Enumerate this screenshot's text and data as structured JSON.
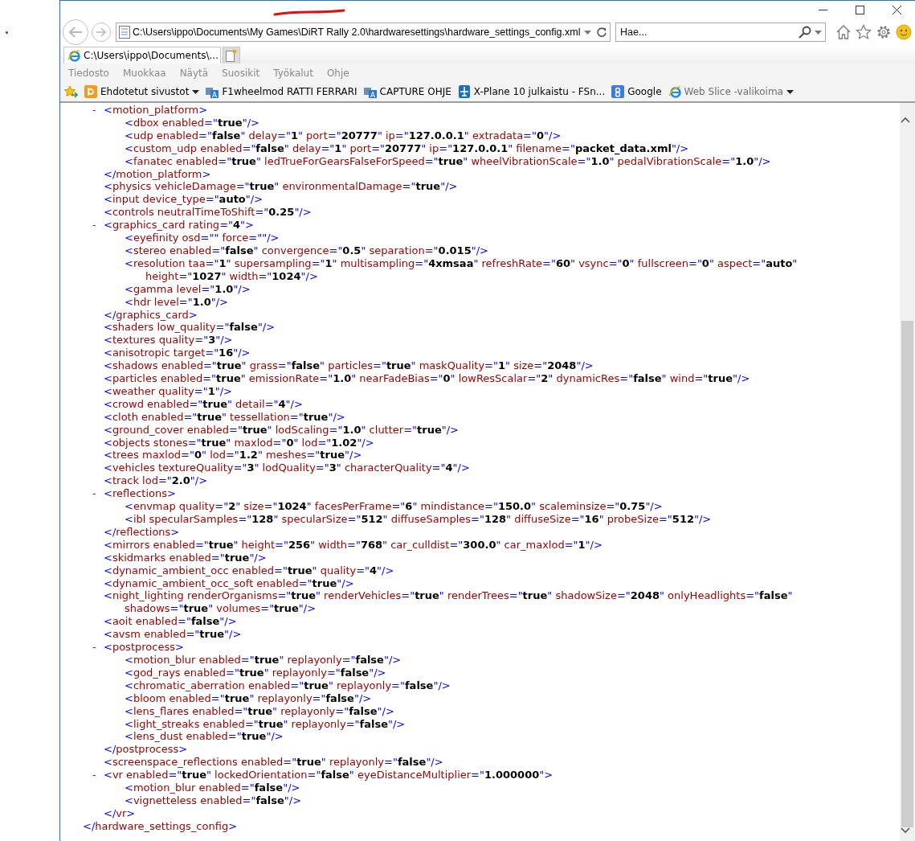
{
  "browser": {
    "address": {
      "value": "C:\\Users\\ippo\\Documents\\My Games\\DiRT Rally 2.0\\hardwaresettings\\hardware_settings_config.xml"
    },
    "search": {
      "placeholder": "Hae..."
    },
    "tabs": [
      {
        "title": "C:\\Users\\ippo\\Documents\\...",
        "selected": true
      }
    ],
    "menu": [
      "Tiedosto",
      "Muokkaa",
      "Näytä",
      "Suosikit",
      "Työkalut",
      "Ohje"
    ],
    "favorites": [
      {
        "label": "Ehdotetut sivustot",
        "kind": "bing",
        "dropdown": true,
        "disabled": false
      },
      {
        "label": "F1wheelmod RATTI FERRARI",
        "kind": "translator",
        "dropdown": false,
        "disabled": false
      },
      {
        "label": "CAPTURE OHJE",
        "kind": "translator",
        "dropdown": false,
        "disabled": false
      },
      {
        "label": "X-Plane 10 julkaistu - FSn...",
        "kind": "plane",
        "dropdown": false,
        "disabled": false
      },
      {
        "label": "Google",
        "kind": "google",
        "dropdown": false,
        "disabled": false
      },
      {
        "label": "Web Slice -valikoima",
        "kind": "ie",
        "dropdown": true,
        "disabled": true
      }
    ]
  },
  "document": {
    "close": "</hardware_settings_config>",
    "children": [
      {
        "toggle": "-",
        "open": "<motion_platform>",
        "close": "</motion_platform>",
        "children": [
          {
            "open": "<dbox enabled=\"true\"/>"
          },
          {
            "open": "<udp enabled=\"false\" delay=\"1\" port=\"20777\" ip=\"127.0.0.1\" extradata=\"0\"/>"
          },
          {
            "open": "<custom_udp enabled=\"false\" delay=\"1\" port=\"20777\" ip=\"127.0.0.1\" filename=\"packet_data.xml\"/>"
          },
          {
            "open": "<fanatec enabled=\"true\" ledTrueForGearsFalseForSpeed=\"true\" wheelVibrationScale=\"1.0\" pedalVibrationScale=\"1.0\"/>"
          }
        ]
      },
      {
        "open": "<physics vehicleDamage=\"true\" environmentalDamage=\"true\"/>"
      },
      {
        "open": "<input device_type=\"auto\"/>"
      },
      {
        "open": "<controls neutralTimeToShift=\"0.25\"/>"
      },
      {
        "toggle": "-",
        "open": "<graphics_card rating=\"4\">",
        "close": "</graphics_card>",
        "children": [
          {
            "open": "<eyefinity osd=\"\" force=\"\"/>"
          },
          {
            "open": "<stereo enabled=\"false\" convergence=\"0.5\" separation=\"0.015\"/>"
          },
          {
            "open": "<resolution taa=\"1\" supersampling=\"1\" multisampling=\"4xmsaa\" refreshRate=\"60\" vsync=\"0\" fullscreen=\"0\" aspect=\"auto\"",
            "wrap": "height=\"1027\" width=\"1024\"/>"
          },
          {
            "open": "<gamma level=\"1.0\"/>"
          },
          {
            "open": "<hdr level=\"1.0\"/>"
          }
        ]
      },
      {
        "open": "<shaders low_quality=\"false\"/>"
      },
      {
        "open": "<textures quality=\"3\"/>"
      },
      {
        "open": "<anisotropic target=\"16\"/>"
      },
      {
        "open": "<shadows enabled=\"true\" grass=\"false\" particles=\"true\" maskQuality=\"1\" size=\"2048\"/>"
      },
      {
        "open": "<particles enabled=\"true\" emissionRate=\"1.0\" nearFadeBias=\"0\" lowResScalar=\"2\" dynamicRes=\"false\" wind=\"true\"/>"
      },
      {
        "open": "<weather quality=\"1\"/>"
      },
      {
        "open": "<crowd enabled=\"true\" detail=\"4\"/>"
      },
      {
        "open": "<cloth enabled=\"true\" tessellation=\"true\"/>"
      },
      {
        "open": "<ground_cover enabled=\"true\" lodScaling=\"1.0\" clutter=\"true\"/>"
      },
      {
        "open": "<objects stones=\"true\" maxlod=\"0\" lod=\"1.02\"/>"
      },
      {
        "open": "<trees maxlod=\"0\" lod=\"1.2\" meshes=\"true\"/>"
      },
      {
        "open": "<vehicles textureQuality=\"3\" lodQuality=\"3\" characterQuality=\"4\"/>"
      },
      {
        "open": "<track lod=\"2.0\"/>"
      },
      {
        "toggle": "-",
        "open": "<reflections>",
        "close": "</reflections>",
        "children": [
          {
            "open": "<envmap quality=\"2\" size=\"1024\" facesPerFrame=\"6\" mindistance=\"150.0\" scaleminsize=\"0.75\"/>"
          },
          {
            "open": "<ibl specularSamples=\"128\" specularSize=\"512\" diffuseSamples=\"128\" diffuseSize=\"16\" probeSize=\"512\"/>"
          }
        ]
      },
      {
        "open": "<mirrors enabled=\"true\" height=\"256\" width=\"768\" car_culldist=\"300.0\" car_maxlod=\"1\"/>"
      },
      {
        "open": "<skidmarks enabled=\"true\"/>"
      },
      {
        "open": "<dynamic_ambient_occ enabled=\"true\" quality=\"4\"/>"
      },
      {
        "open": "<dynamic_ambient_occ_soft enabled=\"true\"/>"
      },
      {
        "open": "<night_lighting renderOrganisms=\"true\" renderVehicles=\"true\" renderTrees=\"true\" shadowSize=\"2048\" onlyHeadlights=\"false\"",
        "wrap": "shadows=\"true\" volumes=\"true\"/>"
      },
      {
        "open": "<aoit enabled=\"false\"/>"
      },
      {
        "open": "<avsm enabled=\"true\"/>"
      },
      {
        "toggle": "-",
        "open": "<postprocess>",
        "close": "</postprocess>",
        "children": [
          {
            "open": "<motion_blur enabled=\"true\" replayonly=\"false\"/>"
          },
          {
            "open": "<god_rays enabled=\"true\" replayonly=\"false\"/>"
          },
          {
            "open": "<chromatic_aberration enabled=\"true\" replayonly=\"false\"/>"
          },
          {
            "open": "<bloom enabled=\"true\" replayonly=\"false\"/>"
          },
          {
            "open": "<lens_flares enabled=\"true\" replayonly=\"false\"/>"
          },
          {
            "open": "<light_streaks enabled=\"true\" replayonly=\"false\"/>"
          },
          {
            "open": "<lens_dust enabled=\"true\"/>"
          }
        ]
      },
      {
        "open": "<screenspace_reflections enabled=\"true\" replayonly=\"false\"/>"
      },
      {
        "toggle": "-",
        "open": "<vr enabled=\"true\" lockedOrientation=\"false\" eyeDistanceMultiplier=\"1.000000\">",
        "close": "</vr>",
        "children": [
          {
            "open": "<motion_blur enabled=\"false\"/>"
          },
          {
            "open": "<vignetteless enabled=\"false\"/>"
          }
        ]
      }
    ]
  }
}
